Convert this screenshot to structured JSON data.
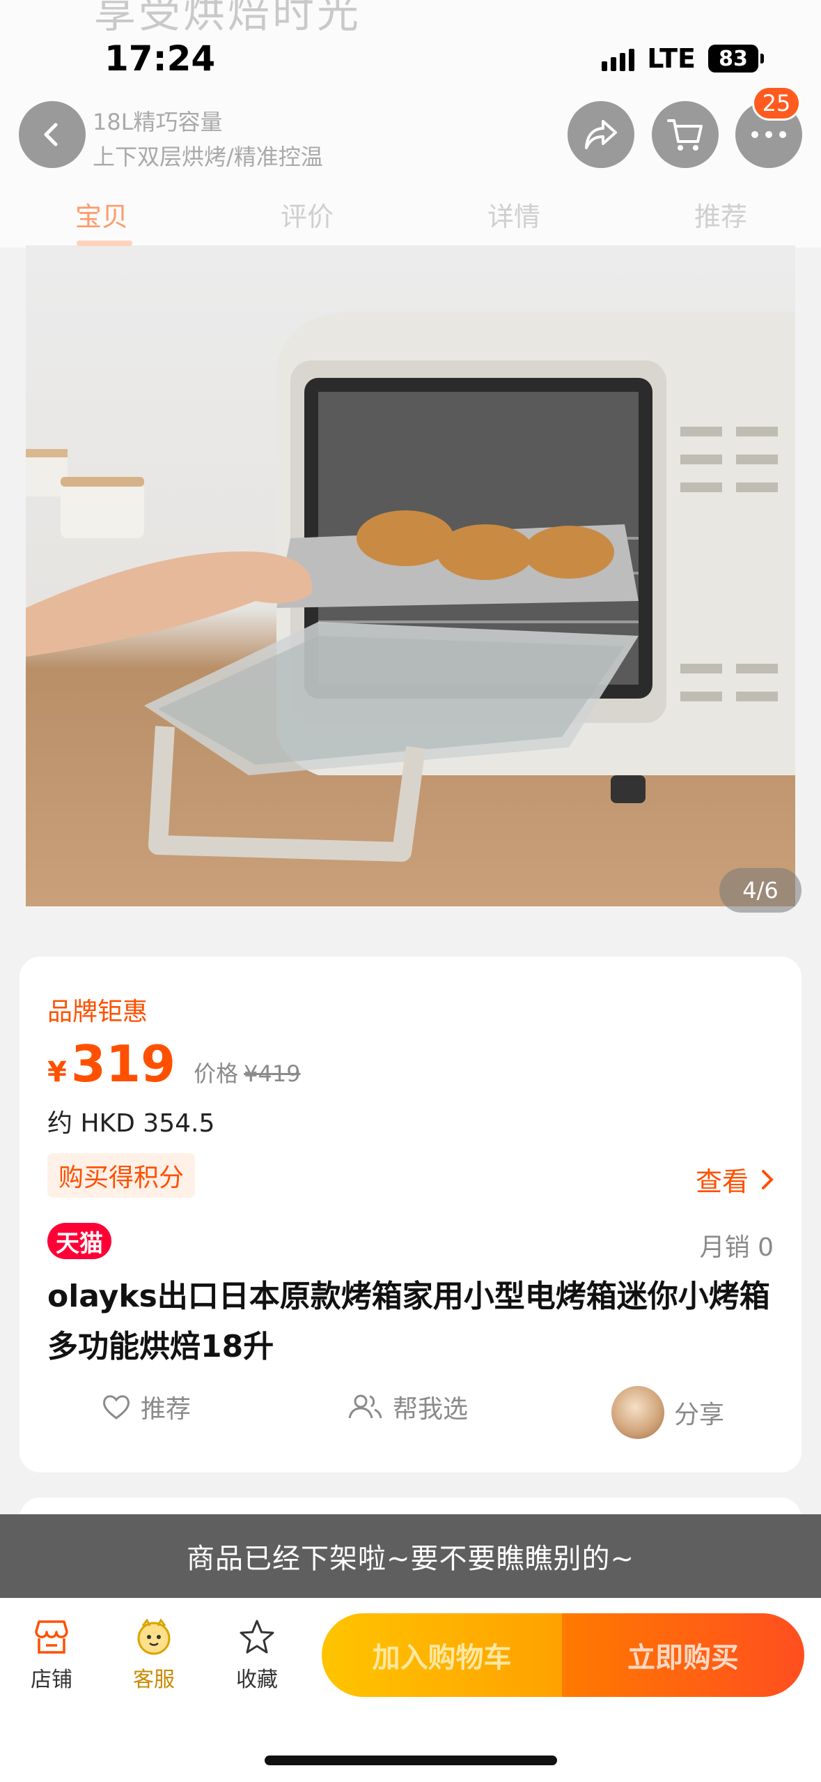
{
  "status_bar": {
    "time": "17:24",
    "network": "LTE",
    "battery": "83"
  },
  "header": {
    "background_title": "享受烘焙时光",
    "subtitle_1": "18L精巧容量",
    "subtitle_2": "上下双层烘烤/精准控温",
    "cart_badge": "25"
  },
  "tabs": [
    {
      "label": "宝贝",
      "active": true
    },
    {
      "label": "评价",
      "active": false
    },
    {
      "label": "详情",
      "active": false
    },
    {
      "label": "推荐",
      "active": false
    }
  ],
  "gallery": {
    "counter": "4/6"
  },
  "price_card": {
    "promo_label": "品牌钜惠",
    "currency_symbol": "¥",
    "price": "319",
    "original_label": "价格",
    "original_price": "¥419",
    "hkd": "约 HKD 354.5",
    "points_tag": "购买得积分",
    "view_link": "查看",
    "platform_tag": "天猫",
    "monthly_sales": "月销 0",
    "title": "olayks出口日本原款烤箱家用小型电烤箱迷你小烤箱多功能烘焙18升",
    "actions": {
      "recommend": "推荐",
      "help_choose": "帮我选",
      "share": "分享"
    }
  },
  "toast": "商品已经下架啦~要不要瞧瞧别的~",
  "bottom_bar": {
    "store": "店铺",
    "service": "客服",
    "favorite": "收藏",
    "add_to_cart": "加入购物车",
    "buy_now": "立即购买"
  },
  "colors": {
    "accent": "#ff5000",
    "cart_button": "#ffb300",
    "buy_button": "#ff5a1f",
    "tmall": "#ff0036"
  }
}
